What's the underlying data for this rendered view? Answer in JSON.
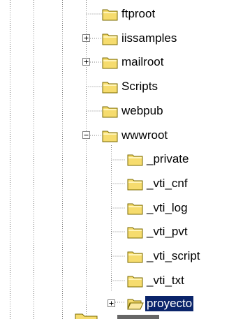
{
  "tree": {
    "items": [
      {
        "label": "ftproot",
        "icon": "folder-icon",
        "expander": "none",
        "selected": false
      },
      {
        "label": "iissamples",
        "icon": "folder-icon",
        "expander": "plus",
        "selected": false
      },
      {
        "label": "mailroot",
        "icon": "folder-icon",
        "expander": "plus",
        "selected": false
      },
      {
        "label": "Scripts",
        "icon": "folder-icon",
        "expander": "none",
        "selected": false
      },
      {
        "label": "webpub",
        "icon": "folder-icon",
        "expander": "none",
        "selected": false
      },
      {
        "label": "wwwroot",
        "icon": "folder-icon",
        "expander": "minus",
        "selected": false
      },
      {
        "label": "_private",
        "icon": "folder-icon",
        "expander": "none",
        "selected": false
      },
      {
        "label": "_vti_cnf",
        "icon": "folder-icon",
        "expander": "none",
        "selected": false
      },
      {
        "label": "_vti_log",
        "icon": "folder-icon",
        "expander": "none",
        "selected": false
      },
      {
        "label": "_vti_pvt",
        "icon": "folder-icon",
        "expander": "none",
        "selected": false
      },
      {
        "label": "_vti_script",
        "icon": "folder-icon",
        "expander": "none",
        "selected": false
      },
      {
        "label": "_vti_txt",
        "icon": "folder-icon",
        "expander": "none",
        "selected": false
      },
      {
        "label": "proyecto",
        "icon": "open-folder-icon",
        "expander": "plus",
        "selected": true
      }
    ]
  },
  "colors": {
    "selection": "#0a246a",
    "folder_fill": "#f6dc6e",
    "folder_stroke": "#7a6a00",
    "guide": "#808080"
  }
}
